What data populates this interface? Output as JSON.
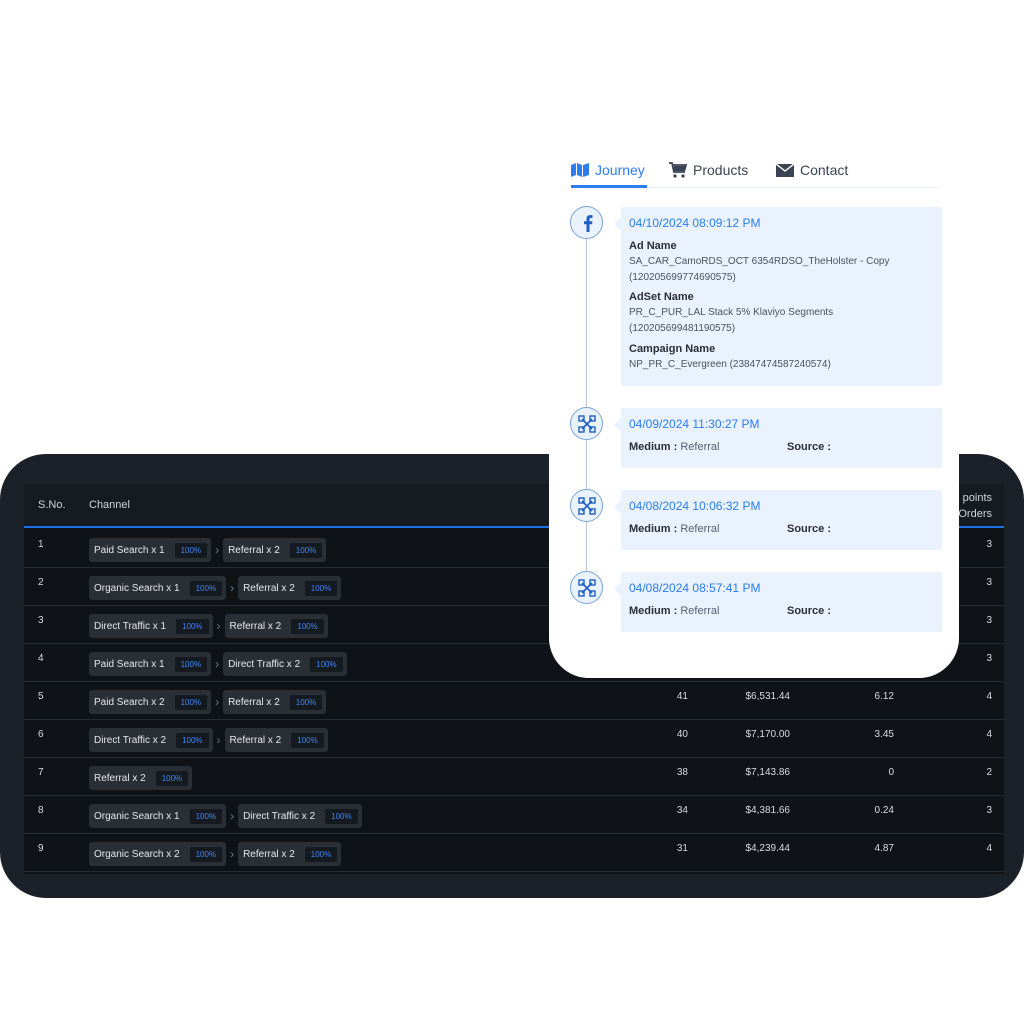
{
  "table": {
    "headers": {
      "sno": "S.No.",
      "channel": "Channel",
      "touchpoints_line1": "points",
      "touchpoints_line2": "Orders"
    },
    "rows": [
      {
        "sno": "1",
        "path": [
          {
            "label": "Paid Search x 1",
            "pct": "100%"
          },
          {
            "label": "Referral x 2",
            "pct": "100%"
          }
        ],
        "visits": "",
        "revenue": "",
        "roas": "",
        "orders": "3"
      },
      {
        "sno": "2",
        "path": [
          {
            "label": "Organic Search x 1",
            "pct": "100%"
          },
          {
            "label": "Referral x 2",
            "pct": "100%"
          }
        ],
        "visits": "",
        "revenue": "",
        "roas": "",
        "orders": "3"
      },
      {
        "sno": "3",
        "path": [
          {
            "label": "Direct Traffic x 1",
            "pct": "100%"
          },
          {
            "label": "Referral x 2",
            "pct": "100%"
          }
        ],
        "visits": "",
        "revenue": "",
        "roas": "",
        "orders": "3"
      },
      {
        "sno": "4",
        "path": [
          {
            "label": "Paid Search x 1",
            "pct": "100%"
          },
          {
            "label": "Direct Traffic x 2",
            "pct": "100%"
          }
        ],
        "visits": "",
        "revenue": "",
        "roas": "",
        "orders": "3"
      },
      {
        "sno": "5",
        "path": [
          {
            "label": "Paid Search x 2",
            "pct": "100%"
          },
          {
            "label": "Referral x 2",
            "pct": "100%"
          }
        ],
        "visits": "41",
        "revenue": "$6,531.44",
        "roas": "6.12",
        "orders": "4"
      },
      {
        "sno": "6",
        "path": [
          {
            "label": "Direct Traffic x 2",
            "pct": "100%"
          },
          {
            "label": "Referral x 2",
            "pct": "100%"
          }
        ],
        "visits": "40",
        "revenue": "$7,170.00",
        "roas": "3.45",
        "orders": "4"
      },
      {
        "sno": "7",
        "path": [
          {
            "label": "Referral x 2",
            "pct": "100%"
          }
        ],
        "visits": "38",
        "revenue": "$7,143.86",
        "roas": "0",
        "orders": "2"
      },
      {
        "sno": "8",
        "path": [
          {
            "label": "Organic Search x 1",
            "pct": "100%"
          },
          {
            "label": "Direct Traffic x 2",
            "pct": "100%"
          }
        ],
        "visits": "34",
        "revenue": "$4,381.66",
        "roas": "0.24",
        "orders": "3"
      },
      {
        "sno": "9",
        "path": [
          {
            "label": "Organic Search x 2",
            "pct": "100%"
          },
          {
            "label": "Referral x 2",
            "pct": "100%"
          }
        ],
        "visits": "31",
        "revenue": "$4,239.44",
        "roas": "4.87",
        "orders": "4"
      }
    ]
  },
  "journey": {
    "tabs": [
      {
        "id": "journey",
        "label": "Journey",
        "icon": "map-icon",
        "active": true
      },
      {
        "id": "products",
        "label": "Products",
        "icon": "cart-icon",
        "active": false
      },
      {
        "id": "contact",
        "label": "Contact",
        "icon": "envelope-icon",
        "active": false
      }
    ],
    "events": [
      {
        "icon": "facebook-icon",
        "date": "04/10/2024 08:09:12 PM",
        "fields": [
          {
            "label": "Ad Name",
            "lines": [
              "SA_CAR_CamoRDS_OCT 6354RDSO_TheHolster - Copy",
              "(120205699774690575)"
            ]
          },
          {
            "label": "AdSet Name",
            "lines": [
              "PR_C_PUR_LAL Stack 5% Klaviyo Segments",
              "(120205699481190575)"
            ]
          },
          {
            "label": "Campaign Name",
            "lines": [
              "NP_PR_C_Evergreen (23847474587240574)"
            ]
          }
        ]
      },
      {
        "icon": "referral-network-icon",
        "date": "04/09/2024 11:30:27 PM",
        "medium_label": "Medium :",
        "medium": "Referral",
        "source_label": "Source :",
        "source": ""
      },
      {
        "icon": "referral-network-icon",
        "date": "04/08/2024 10:06:32 PM",
        "medium_label": "Medium :",
        "medium": "Referral",
        "source_label": "Source :",
        "source": ""
      },
      {
        "icon": "referral-network-icon",
        "date": "04/08/2024 08:57:41 PM",
        "medium_label": "Medium :",
        "medium": "Referral",
        "source_label": "Source :",
        "source": ""
      }
    ]
  },
  "colors": {
    "accent": "#2b7df0",
    "table_bg": "#0f1216",
    "card_bg": "#1b2129",
    "event_bg": "#e9f2fd"
  }
}
